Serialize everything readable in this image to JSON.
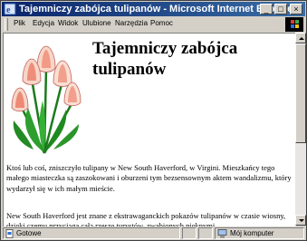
{
  "window": {
    "title": "Tajemniczy zabójca tulipanów - Microsoft Internet Explorer",
    "min_glyph": "_",
    "max_glyph": "□",
    "close_glyph": "×"
  },
  "menu": {
    "items": [
      "Plik",
      "Edycja",
      "Widok",
      "Ulubione",
      "Narzędzia",
      "Pomoc"
    ]
  },
  "page": {
    "heading": "Tajemniczy zabójca tulipanów",
    "paragraph1": "Ktoś lub coś, zniszczyło tulipany w New South Haverford, w Virgini. Mieszkańcy tego małego miasteczka są zaszokowani i oburzeni tym bezsensownym aktem wandalizmu, który wydarzył się w ich małym mieście.",
    "paragraph2": "New South Haverford jest znane z ekstrawaganckich pokazów tulipanów w czasie wiosny, dzięki czemu przyciąga całą rzeszę turystów, zwabionych pięknymi"
  },
  "status": {
    "left": "Gotowe",
    "right": "Mój komputer"
  },
  "colors": {
    "titlebar_start": "#0a246a",
    "titlebar_end": "#3a6ea5",
    "chrome": "#d4d0c8"
  }
}
